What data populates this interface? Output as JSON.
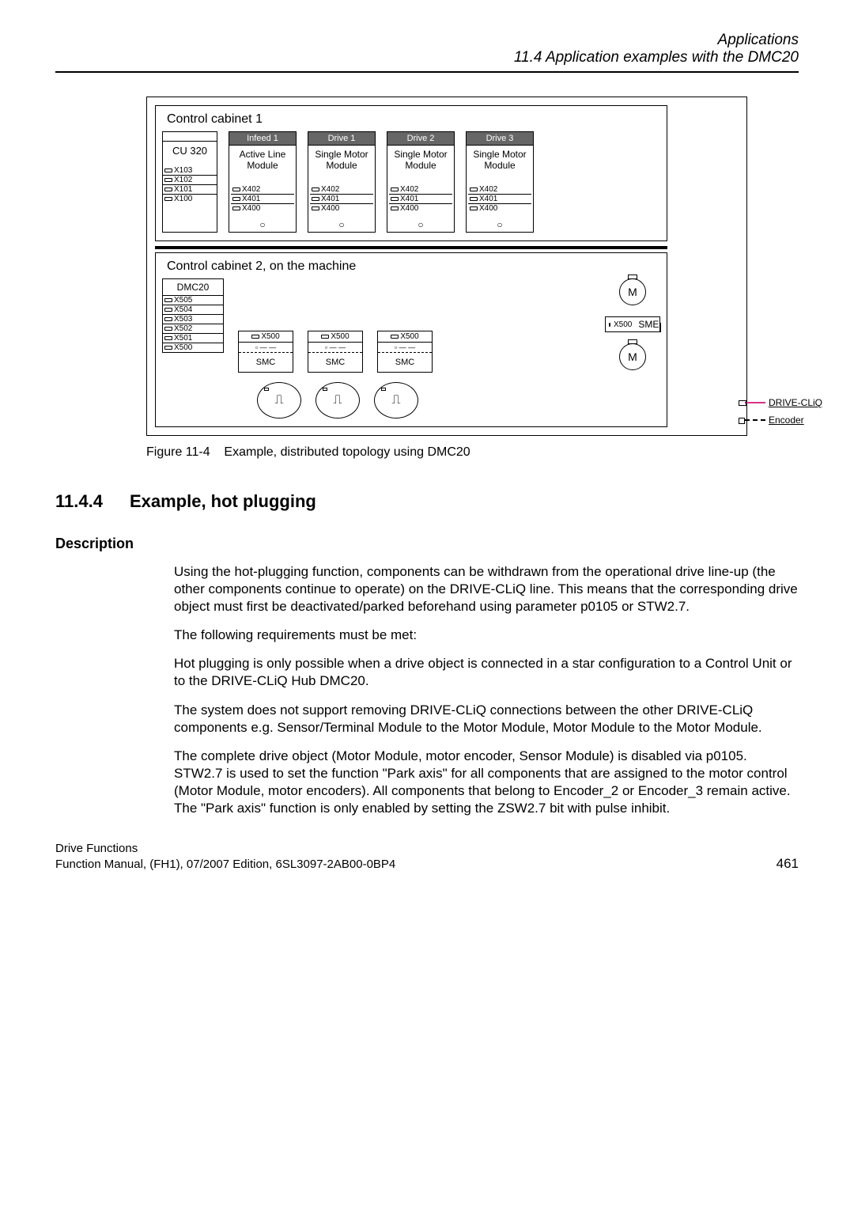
{
  "header": {
    "line1": "Applications",
    "line2": "11.4 Application examples with the DMC20"
  },
  "diagram": {
    "cab1_title": "Control cabinet 1",
    "cu": {
      "title": "CU 320",
      "ports": [
        "X103",
        "X102",
        "X101",
        "X100"
      ]
    },
    "mods": [
      {
        "label": "Infeed 1",
        "name": "Active Line Module",
        "ports": [
          "X402",
          "X401",
          "X400"
        ]
      },
      {
        "label": "Drive 1",
        "name": "Single Motor Module",
        "ports": [
          "X402",
          "X401",
          "X400"
        ]
      },
      {
        "label": "Drive 2",
        "name": "Single Motor Module",
        "ports": [
          "X402",
          "X401",
          "X400"
        ]
      },
      {
        "label": "Drive 3",
        "name": "Single Motor Module",
        "ports": [
          "X402",
          "X401",
          "X400"
        ]
      }
    ],
    "cab2_title": "Control cabinet 2, on the machine",
    "dmc": {
      "title": "DMC20",
      "ports": [
        "X505",
        "X504",
        "X503",
        "X502",
        "X501",
        "X500"
      ]
    },
    "smc": [
      {
        "top": "X500",
        "name": "SMC"
      },
      {
        "top": "X500",
        "name": "SMC"
      },
      {
        "top": "X500",
        "name": "SMC"
      }
    ],
    "sme": {
      "port": "X500",
      "name": "SME"
    },
    "m_label": "M",
    "legend_driveclick": "DRIVE-CLiQ",
    "legend_encoder": "Encoder"
  },
  "figcap": {
    "num": "Figure 11-4",
    "text": "Example, distributed topology using DMC20"
  },
  "section": {
    "num": "11.4.4",
    "title": "Example, hot plugging",
    "desc_head": "Description"
  },
  "paras": {
    "p1": "Using the hot-plugging function, components can be withdrawn from the operational drive line-up (the other components continue to operate) on the DRIVE-CLiQ line. This means that the corresponding drive object must first be deactivated/parked beforehand using parameter p0105 or STW2.7.",
    "p2": "The following requirements must be met:",
    "p3": "Hot plugging is only possible when a drive object is connected in a star configuration to a Control Unit or to the DRIVE-CLiQ Hub DMC20.",
    "p4": "The system does not support removing DRIVE-CLiQ connections between the other DRIVE-CLiQ components e.g. Sensor/Terminal Module to the Motor Module, Motor Module to the Motor Module.",
    "p5": "The complete drive object (Motor Module, motor encoder, Sensor Module) is disabled via p0105.\nSTW2.7 is used to set the function \"Park axis\" for all components that are assigned to the motor control (Motor Module, motor encoders). All components that belong to Encoder_2 or Encoder_3 remain active. The \"Park axis\" function is only enabled by setting the ZSW2.7 bit with pulse inhibit."
  },
  "footer": {
    "l1": "Drive Functions",
    "l2": "Function Manual, (FH1), 07/2007 Edition, 6SL3097-2AB00-0BP4",
    "page": "461"
  }
}
